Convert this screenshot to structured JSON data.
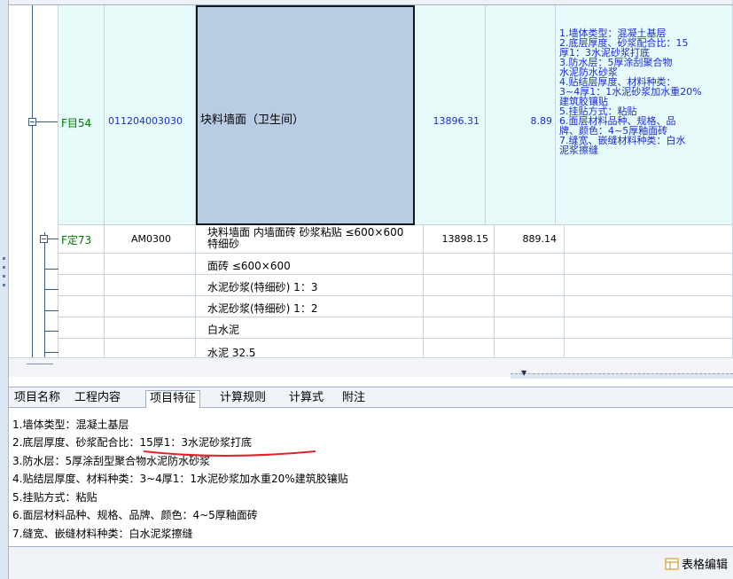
{
  "grid": {
    "row1": {
      "code": "F目54",
      "number": "011204003030",
      "name": "块料墙面（卫生间）",
      "qty": "13896.31",
      "price": "8.89",
      "feature": "1.墙体类型：混凝土基层\n2.底层厚度、砂浆配合比：15\n厚1：3水泥砂浆打底\n3.防水层：5厚涂刮聚合物\n水泥防水砂浆\n4.贴结层厚度、材料种类：\n3~4厚1：1水泥砂浆加水重20%\n建筑胶镶贴\n5.挂贴方式：粘贴\n6.面层材料品种、规格、品\n牌、颜色：4~5厚釉面砖\n7.缝宽、嵌缝材料种类：白水\n泥浆擦缝"
    },
    "row2": {
      "code": "F定73",
      "number": "AM0300",
      "name": "块料墙面 内墙面砖 砂浆粘贴 ≤600×600 特细砂",
      "qty": "13898.15",
      "price": "889.14"
    },
    "materials": [
      "面砖 ≤600×600",
      "水泥砂浆(特细砂) 1：3",
      "水泥砂浆(特细砂) 1：2",
      "白水泥",
      "水泥 32.5"
    ]
  },
  "tabs": [
    "项目名称",
    "工程内容",
    "项目特征",
    "计算规则",
    "计算式",
    "附注"
  ],
  "active_tab": "项目特征",
  "feature_lines": [
    "1.墙体类型：混凝土基层",
    "2.底层厚度、砂浆配合比：15厚1：3水泥砂浆打底",
    "3.防水层：5厚涂刮型聚合物水泥防水砂浆",
    "4.贴结层厚度、材料种类：3~4厚1：1水泥砂浆加水重20%建筑胶镶贴",
    "5.挂贴方式：粘贴",
    "6.面层材料品种、规格、品牌、颜色：4~5厚釉面砖",
    "7.缝宽、嵌缝材料种类：白水泥浆擦缝"
  ],
  "bottom": {
    "edit_label": "表格编辑"
  },
  "colors": {
    "selected": "#b8cce4",
    "cyan_row": "#e8fbfb",
    "code_green": "#007a00",
    "feature_blue": "#1a2bd4",
    "annotation_red": "#e0242a"
  }
}
